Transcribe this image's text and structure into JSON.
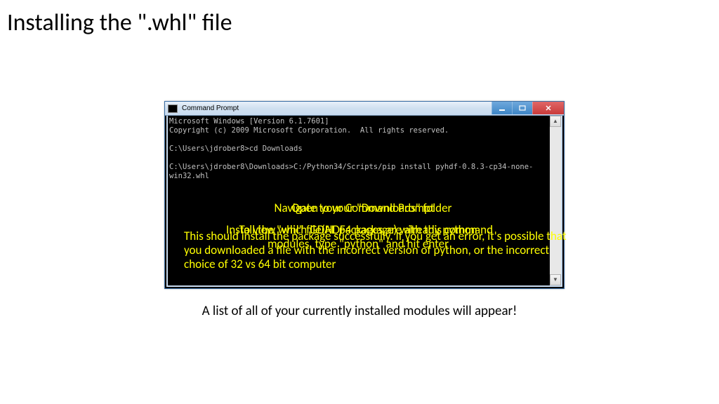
{
  "title": "Installing the \".whl\" file",
  "window": {
    "title": "Command Prompt",
    "lines": {
      "l1": "Microsoft Windows [Version 6.1.7601]",
      "l2": "Copyright (c) 2009 Microsoft Corporation.  All rights reserved.",
      "l3": "",
      "l4": "C:\\Users\\jdrober8>cd Downloads",
      "l5": "",
      "l6": "C:\\Users\\jdrober8\\Downloads>C:/Python34/Scripts/pip install pyhdf-0.8.3-cp34-none-win32.whl"
    }
  },
  "overlays": {
    "o1": "Open your Command Prompt",
    "o2": "Navigate to your \"Downloads\" folder",
    "o3": "Install the \"whl\" file(HDF4 package) with this command",
    "o4": "To view which GDAL packages are already python modules, type \"python\" and hit enter",
    "o5": "This should install the package successfully. If you get an error, it's possible that you downloaded a file with the incorrect version of python, or the incorrect choice of 32 vs 64 bit computer"
  },
  "caption": "A list of all of your currently installed modules will appear!"
}
